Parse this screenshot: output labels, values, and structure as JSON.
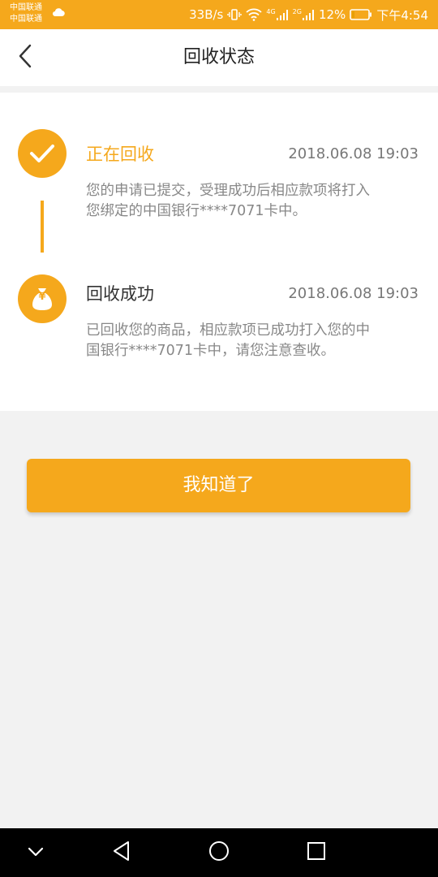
{
  "status_bar": {
    "carrier_1": "中国联通",
    "carrier_2": "中国联通",
    "net_speed": "33B/s",
    "net_4g": "4G",
    "net_2g": "2G",
    "battery": "12%",
    "time": "下午4:54"
  },
  "header": {
    "title": "回收状态"
  },
  "timeline": {
    "steps": [
      {
        "title": "正在回收",
        "time": "2018.06.08 19:03",
        "desc_line1": "您的申请已提交，受理成功后相应款项将打入",
        "desc_line2": "您绑定的中国银行****7071卡中。",
        "icon": "check-icon",
        "title_color": "#f5a81c"
      },
      {
        "title": "回收成功",
        "time": "2018.06.08 19:03",
        "desc_line1": "已回收您的商品，相应款项已成功打入您的中",
        "desc_line2": "国银行****7071卡中，请您注意查收。",
        "icon": "money-bag-icon",
        "icon_glyph": "¥",
        "title_color": "#333333"
      }
    ]
  },
  "actions": {
    "ack_label": "我知道了"
  },
  "colors": {
    "accent": "#f5a81c",
    "background": "#f2f2f2"
  }
}
